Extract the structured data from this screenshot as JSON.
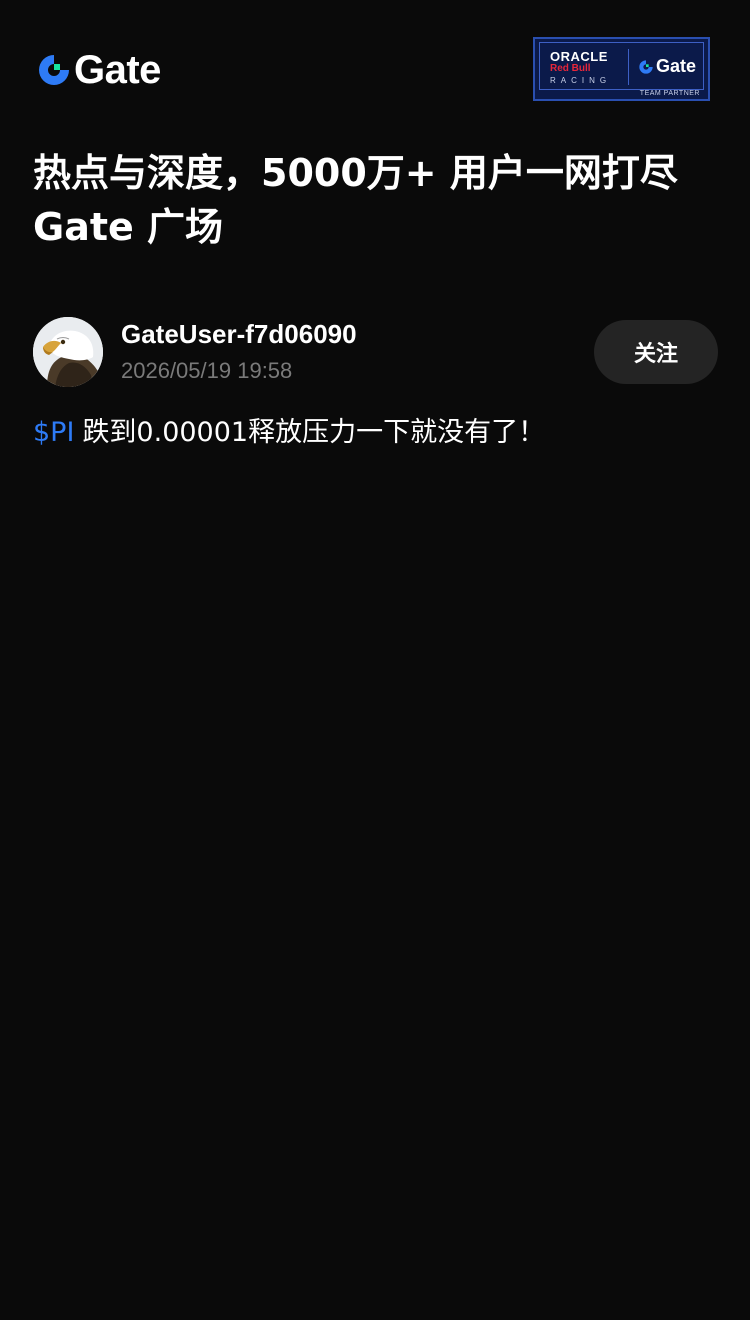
{
  "header": {
    "logo_text": "Gate",
    "partner": {
      "oracle": "ORACLE",
      "redbull": "Red Bull",
      "racing": "RACING",
      "gate": "Gate",
      "team": "TEAM PARTNER"
    }
  },
  "headline": {
    "line1": "热点与深度，5000万+ 用户一网打尽",
    "line2": "Gate 广场"
  },
  "post": {
    "username": "GateUser-f7d06090",
    "timestamp": "2026/05/19 19:58",
    "follow_label": "关注",
    "ticker": "$PI",
    "text": "跌到0.00001释放压力一下就没有了！"
  },
  "colors": {
    "background": "#0a0a0a",
    "brand_blue": "#2e7bf6",
    "brand_green": "#17e6a1",
    "follow_bg": "#242424",
    "muted_text": "#7a7a7a"
  },
  "icons": {
    "logo": "gate-logo-icon",
    "avatar": "eagle-avatar"
  }
}
